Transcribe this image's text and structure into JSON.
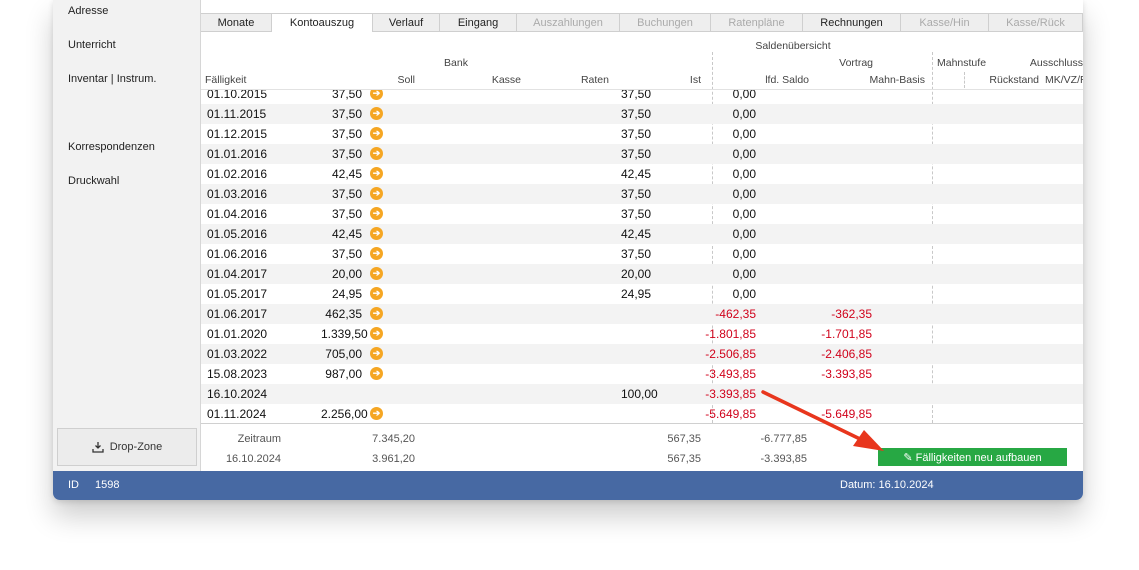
{
  "sidebar": {
    "items": [
      {
        "label": "Adresse"
      },
      {
        "label": "Unterricht"
      },
      {
        "label": "Inventar | Instrum."
      },
      {
        "label": "Korrespondenzen"
      },
      {
        "label": "Druckwahl"
      }
    ],
    "dropzone_label": "Drop-Zone"
  },
  "tabs": [
    {
      "label": "Monate",
      "state": "normal"
    },
    {
      "label": "Kontoauszug",
      "state": "active"
    },
    {
      "label": "Verlauf",
      "state": "normal"
    },
    {
      "label": "Eingang",
      "state": "normal"
    },
    {
      "label": "Auszahlungen",
      "state": "disabled"
    },
    {
      "label": "Buchungen",
      "state": "disabled"
    },
    {
      "label": "Ratenpläne",
      "state": "disabled"
    },
    {
      "label": "Rechnungen",
      "state": "normal"
    },
    {
      "label": "Kasse/Hin",
      "state": "disabled"
    },
    {
      "label": "Kasse/Rück",
      "state": "disabled"
    }
  ],
  "columns": {
    "saldenuebersicht": "Saldenübersicht",
    "bank": "Bank",
    "vortrag": "Vortrag",
    "mahnstufe": "Mahnstufe",
    "ausschluss": "Ausschluss",
    "faelligkeit": "Fälligkeit",
    "soll": "Soll",
    "kasse": "Kasse",
    "raten": "Raten",
    "ist": "Ist",
    "lfd_saldo": "lfd. Saldo",
    "mahn_basis": "Mahn-Basis",
    "rueckstand": "Rückstand",
    "mk_vz_rl": "MK/VZ/RL"
  },
  "rows": [
    {
      "date": "01.10.2015",
      "soll": "37,50",
      "arrow": true,
      "ist": "37,50",
      "saldo": "0,00",
      "mahnbasis": ""
    },
    {
      "date": "01.11.2015",
      "soll": "37,50",
      "arrow": true,
      "ist": "37,50",
      "saldo": "0,00",
      "mahnbasis": ""
    },
    {
      "date": "01.12.2015",
      "soll": "37,50",
      "arrow": true,
      "ist": "37,50",
      "saldo": "0,00",
      "mahnbasis": ""
    },
    {
      "date": "01.01.2016",
      "soll": "37,50",
      "arrow": true,
      "ist": "37,50",
      "saldo": "0,00",
      "mahnbasis": ""
    },
    {
      "date": "01.02.2016",
      "soll": "42,45",
      "arrow": true,
      "ist": "42,45",
      "saldo": "0,00",
      "mahnbasis": ""
    },
    {
      "date": "01.03.2016",
      "soll": "37,50",
      "arrow": true,
      "ist": "37,50",
      "saldo": "0,00",
      "mahnbasis": ""
    },
    {
      "date": "01.04.2016",
      "soll": "37,50",
      "arrow": true,
      "ist": "37,50",
      "saldo": "0,00",
      "mahnbasis": ""
    },
    {
      "date": "01.05.2016",
      "soll": "42,45",
      "arrow": true,
      "ist": "42,45",
      "saldo": "0,00",
      "mahnbasis": ""
    },
    {
      "date": "01.06.2016",
      "soll": "37,50",
      "arrow": true,
      "ist": "37,50",
      "saldo": "0,00",
      "mahnbasis": ""
    },
    {
      "date": "01.04.2017",
      "soll": "20,00",
      "arrow": true,
      "ist": "20,00",
      "saldo": "0,00",
      "mahnbasis": ""
    },
    {
      "date": "01.05.2017",
      "soll": "24,95",
      "arrow": true,
      "ist": "24,95",
      "saldo": "0,00",
      "mahnbasis": ""
    },
    {
      "date": "01.06.2017",
      "soll": "462,35",
      "arrow": true,
      "ist": "",
      "saldo": "-462,35",
      "mahnbasis": "-362,35"
    },
    {
      "date": "01.01.2020",
      "soll": "1.339,50",
      "arrow": true,
      "ist": "",
      "saldo": "-1.801,85",
      "mahnbasis": "-1.701,85"
    },
    {
      "date": "01.03.2022",
      "soll": "705,00",
      "arrow": true,
      "ist": "",
      "saldo": "-2.506,85",
      "mahnbasis": "-2.406,85"
    },
    {
      "date": "15.08.2023",
      "soll": "987,00",
      "arrow": true,
      "ist": "",
      "saldo": "-3.493,85",
      "mahnbasis": "-3.393,85"
    },
    {
      "date": "16.10.2024",
      "soll": "",
      "arrow": false,
      "ist": "100,00",
      "saldo": "-3.393,85",
      "mahnbasis": ""
    },
    {
      "date": "01.11.2024",
      "soll": "2.256,00",
      "arrow": true,
      "ist": "",
      "saldo": "-5.649,85",
      "mahnbasis": "-5.649,85"
    }
  ],
  "footer": {
    "line1": {
      "label": "Zeitraum",
      "soll": "7.345,20",
      "ist": "567,35",
      "saldo": "-6.777,85"
    },
    "line2": {
      "label": "16.10.2024",
      "soll": "3.961,20",
      "ist": "567,35",
      "saldo": "-3.393,85"
    }
  },
  "rebuild_button": "Fälligkeiten neu aufbauen",
  "status": {
    "id_label": "ID",
    "id_value": "1598",
    "datum": "Datum: 16.10.2024"
  },
  "colors": {
    "accent_blue": "#4769a3",
    "negative": "#d0021b",
    "arrow_icon": "#f5a623",
    "button_green": "#27a844",
    "annotation_arrow": "#e8361d"
  }
}
